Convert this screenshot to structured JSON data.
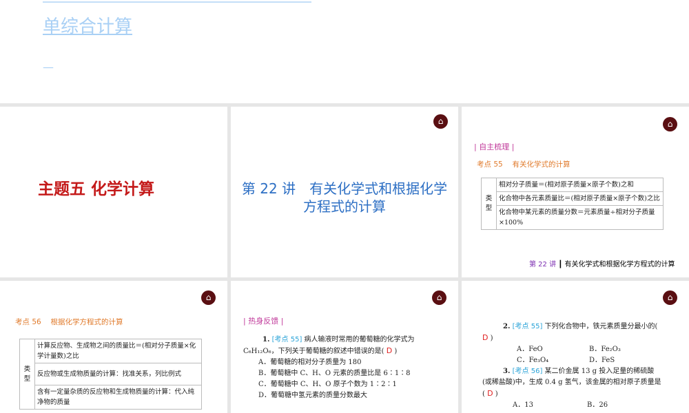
{
  "top_slide": {
    "title_line": "单综合计算",
    "dash": "—"
  },
  "slide1": {
    "title": "主题五 化学计算"
  },
  "slide2": {
    "title": "第 22 讲　有关化学式和根据化学方程式的计算"
  },
  "slide3": {
    "section": "| 自主梳理 |",
    "kaodian": "考点 55　 有关化学式的计算",
    "type_label": "类型",
    "rows": [
      "相对分子质量＝(相对原子质量×原子个数)之和",
      "化合物中各元素质量比＝(相对原子质量×原子个数)之比",
      "化合物中某元素的质量分数＝元素质量÷相对分子质量×100%"
    ],
    "footer_lecture": "第 22 讲",
    "footer_title": "有关化学式和根据化学方程式的计算"
  },
  "slide4": {
    "kaodian": "考点 56　 根据化学方程式的计算",
    "type_label": "类型",
    "rows": [
      "计算反应物、生成物之间的质量比＝(相对分子质量×化学计量数)之比",
      "反应物或生成物质量的计算：找准关系，列比例式",
      "含有一定量杂质的反应物和生成物质量的计算：代入纯净物的质量"
    ]
  },
  "slide5": {
    "section": "| 热身反馈 |",
    "num": "1.",
    "tag": "[考点 55]",
    "stem1": "病人输液时常用的葡萄糖的化学式为 C₆H₁₂O₆，下列关于葡萄糖的叙述中错误的是(",
    "answer": "D",
    "stem_end": ")",
    "options": [
      "A．葡萄糖的相对分子质量为 180",
      "B．葡萄糖中 C、H、O 元素的质量比是 6∶1∶8",
      "C．葡萄糖中 C、H、O 原子个数为 1∶2∶1",
      "D．葡萄糖中氢元素的质量分数最大"
    ]
  },
  "slide6": {
    "q2": {
      "num": "2.",
      "tag": "[考点 55]",
      "stem": "下列化合物中，铁元素质量分最小的(",
      "answer": "D",
      "end": ")",
      "options": [
        "A．FeO",
        "B．Fe₂O₃",
        "C．Fe₃O₄",
        "D．FeS"
      ]
    },
    "q3": {
      "num": "3.",
      "tag": "[考点 56]",
      "stem": "某二价金属 13 g 投入足量的稀硫酸(或稀盐酸)中，生成 0.4 g 氢气，该金属的相对原子质量是(",
      "answer": "D",
      "end": ")",
      "options": [
        "A．13",
        "B．26"
      ]
    }
  },
  "home_icon": "⌂"
}
